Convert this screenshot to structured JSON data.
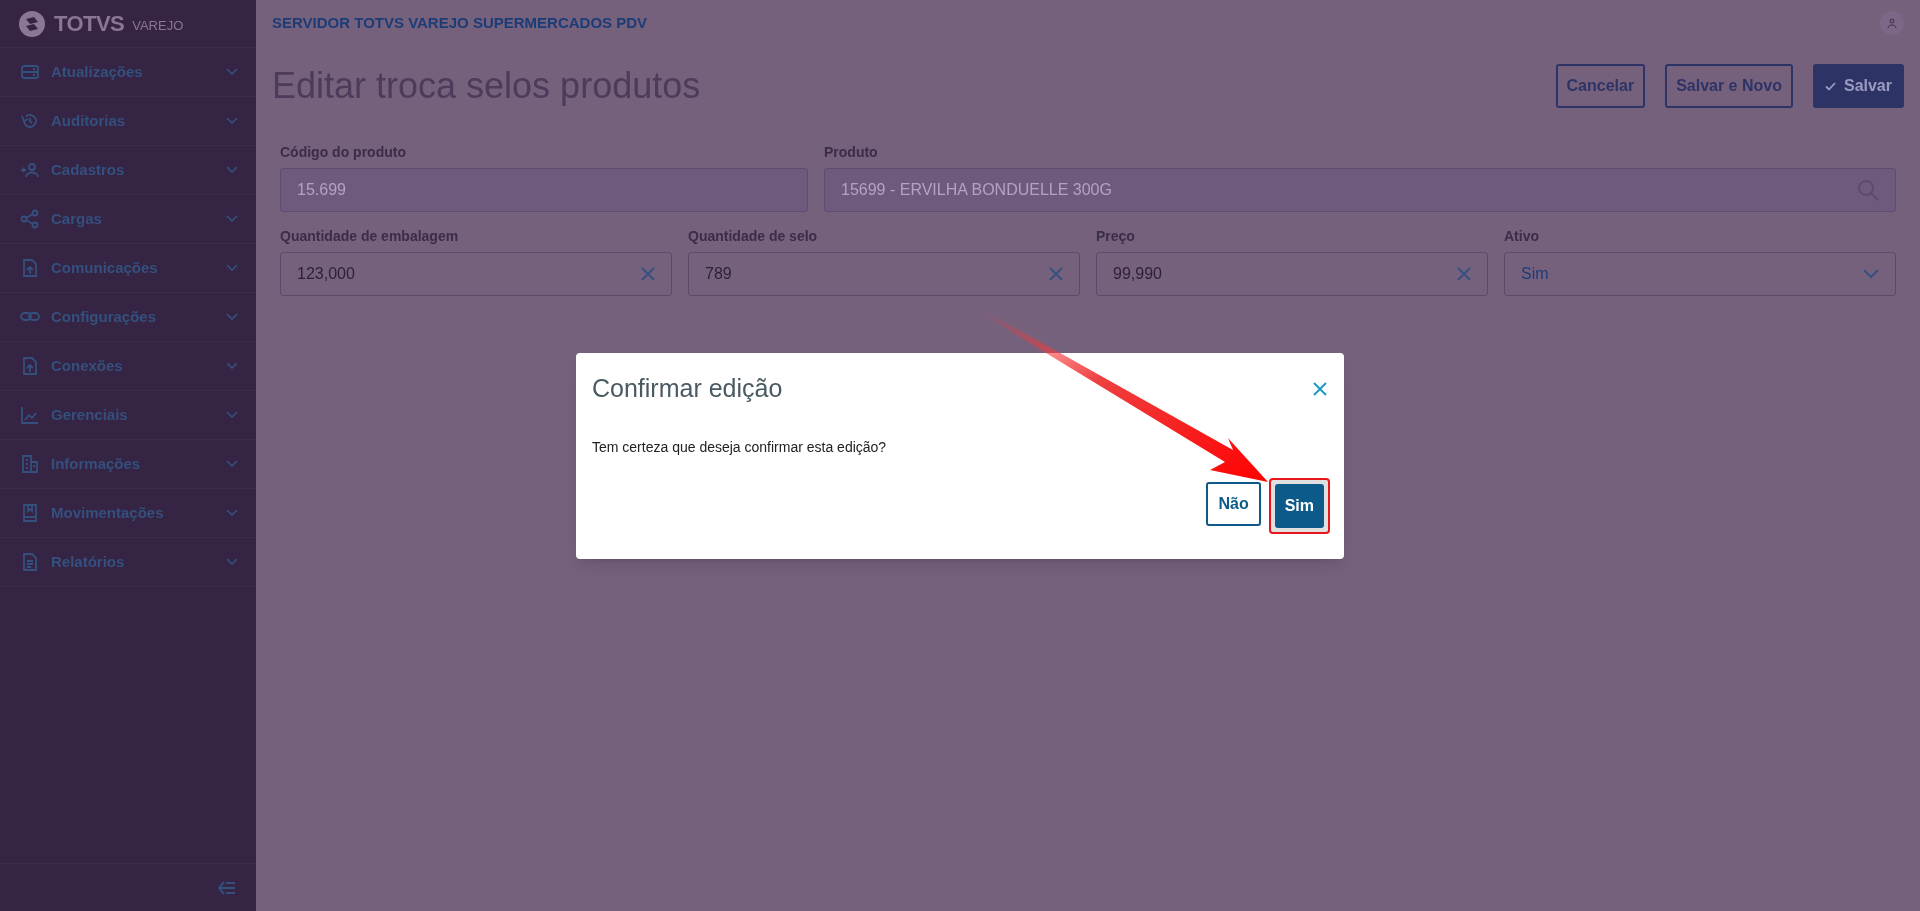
{
  "brand": {
    "name": "TOTVS",
    "suffix": "VAREJO"
  },
  "sidebar": {
    "items": [
      {
        "label": "Atualizações"
      },
      {
        "label": "Auditorias"
      },
      {
        "label": "Cadastros"
      },
      {
        "label": "Cargas"
      },
      {
        "label": "Comunicações"
      },
      {
        "label": "Configurações"
      },
      {
        "label": "Conexões"
      },
      {
        "label": "Gerenciais"
      },
      {
        "label": "Informações"
      },
      {
        "label": "Movimentações"
      },
      {
        "label": "Relatórios"
      }
    ]
  },
  "header": {
    "title": "SERVIDOR TOTVS VAREJO SUPERMERCADOS PDV"
  },
  "page": {
    "title": "Editar troca selos produtos",
    "actions": [
      {
        "label": "Cancelar",
        "primary": false
      },
      {
        "label": "Salvar e Novo",
        "primary": false
      },
      {
        "label": "Salvar",
        "primary": true
      }
    ]
  },
  "form": {
    "rows": [
      [
        {
          "label": "Código do produto",
          "value": "15.699",
          "kind": "text",
          "disabled": true
        },
        {
          "label": "Produto",
          "value": "15699 - ERVILHA BONDUELLE 300G",
          "kind": "search",
          "disabled": true
        }
      ],
      [
        {
          "label": "Quantidade de embalagem",
          "value": "123,000",
          "kind": "clearable",
          "disabled": false
        },
        {
          "label": "Quantidade de selo",
          "value": "789",
          "kind": "clearable",
          "disabled": false
        },
        {
          "label": "Preço",
          "value": "99,990",
          "kind": "clearable",
          "disabled": false
        },
        {
          "label": "Ativo",
          "value": "Sim",
          "kind": "select",
          "disabled": false
        }
      ]
    ]
  },
  "dialog": {
    "title": "Confirmar edição",
    "message": "Tem certeza que deseja confirmar esta edição?",
    "buttons": [
      {
        "label": "Não",
        "primary": false,
        "highlighted": false
      },
      {
        "label": "Sim",
        "primary": true,
        "highlighted": true
      }
    ]
  }
}
